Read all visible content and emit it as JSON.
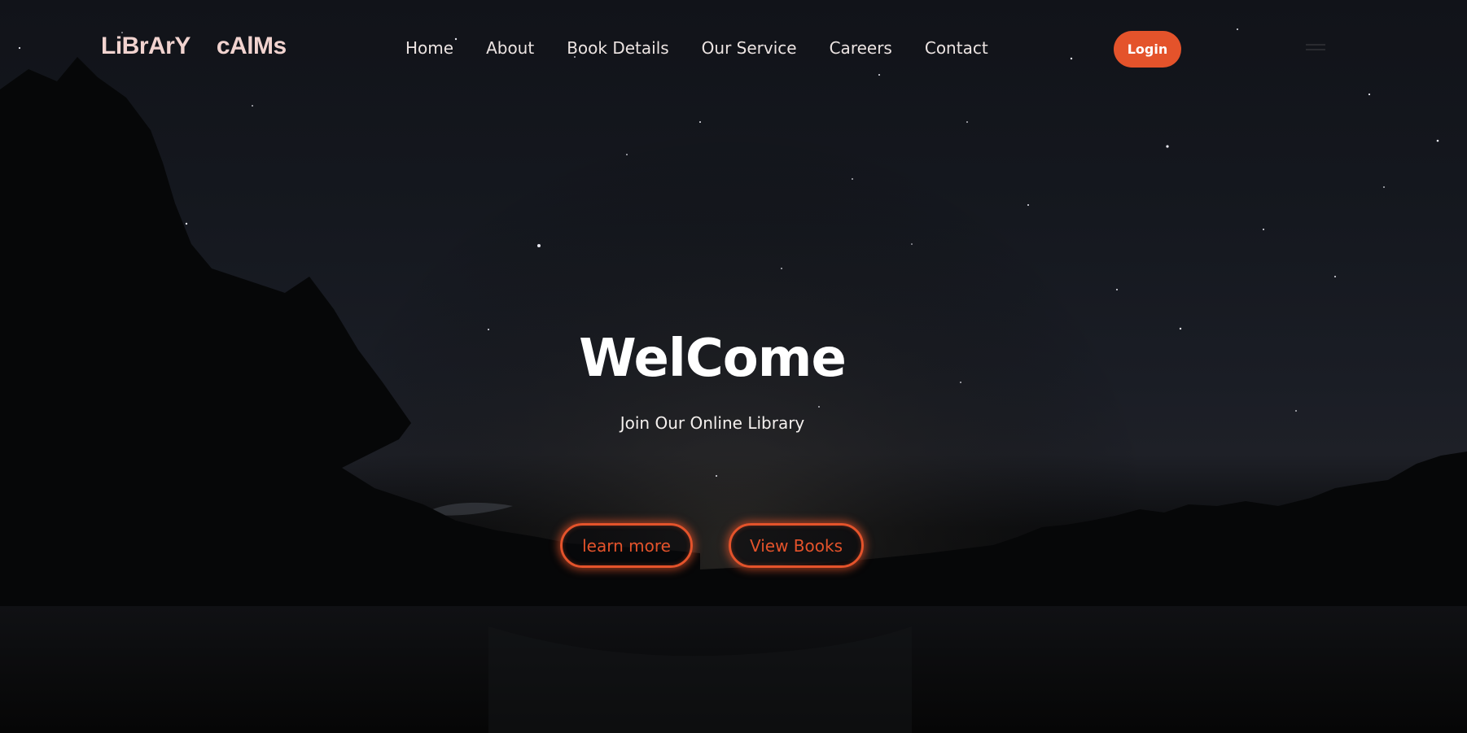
{
  "brand": {
    "word1": "LiBrArY",
    "word2": "cAlMs"
  },
  "nav": {
    "items": [
      "Home",
      "About",
      "Book Details",
      "Our Service",
      "Careers",
      "Contact"
    ]
  },
  "header": {
    "login_label": "Login"
  },
  "hero": {
    "title": "WelCome",
    "subtitle": "Join Our Online Library",
    "learn_more_label": "learn more",
    "view_books_label": "View Books"
  },
  "colors": {
    "accent": "#e4532b",
    "brand_text": "#f1d3cf",
    "background": "#111319"
  }
}
